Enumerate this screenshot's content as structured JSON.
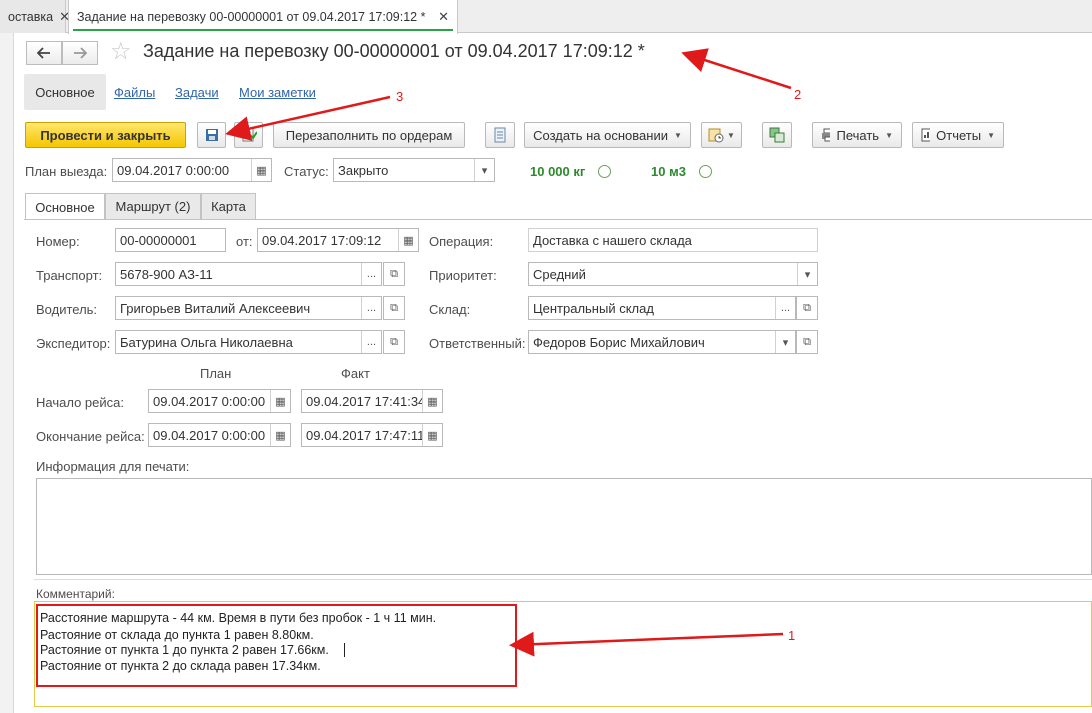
{
  "window_tabs": [
    {
      "label": "оставка",
      "close": "✕"
    },
    {
      "label": "Задание на перевозку 00-00000001 от 09.04.2017 17:09:12 *",
      "close": "✕"
    }
  ],
  "header": {
    "title": "Задание на перевозку 00-00000001 от 09.04.2017 17:09:12 *",
    "back_icon": "arrow-left-icon",
    "forward_icon": "arrow-right-icon",
    "star_icon": "star-icon"
  },
  "sections": {
    "main": "Основное",
    "files": "Файлы",
    "tasks": "Задачи",
    "notes": "Мои заметки"
  },
  "toolbar": {
    "post_close": "Провести и закрыть",
    "refill": "Перезаполнить по ордерам",
    "create_based": "Создать на основании",
    "print": "Печать",
    "reports": "Отчеты"
  },
  "plan_row": {
    "plan_label": "План выезда:",
    "plan_value": "09.04.2017  0:00:00",
    "status_label": "Статус:",
    "status_value": "Закрыто",
    "weight": "10 000 кг",
    "volume": "10 м3"
  },
  "inner_tabs": [
    "Основное",
    "Маршрут (2)",
    "Карта"
  ],
  "form": {
    "number_label": "Номер:",
    "number_value": "00-00000001",
    "from_label": "от:",
    "date_value": "09.04.2017 17:09:12",
    "operation_label": "Операция:",
    "operation_value": "Доставка с нашего склада",
    "transport_label": "Транспорт:",
    "transport_value": "5678-900 АЗ-11",
    "priority_label": "Приоритет:",
    "priority_value": "Средний",
    "driver_label": "Водитель:",
    "driver_value": "Григорьев Виталий Алексеевич",
    "warehouse_label": "Склад:",
    "warehouse_value": "Центральный склад",
    "forwarder_label": "Экспедитор:",
    "forwarder_value": "Батурина Ольга Николаевна",
    "responsible_label": "Ответственный:",
    "responsible_value": "Федоров Борис Михайлович",
    "plan_header": "План",
    "fact_header": "Факт",
    "trip_start_label": "Начало рейса:",
    "trip_start_plan": "09.04.2017  0:00:00",
    "trip_start_fact": "09.04.2017 17:41:34",
    "trip_end_label": "Окончание рейса:",
    "trip_end_plan": "09.04.2017  0:00:00",
    "trip_end_fact": "09.04.2017 17:47:11",
    "print_info_label": "Информация для печати:",
    "comment_label": "Комментарий:",
    "comment_lines": [
      "Расстояние маршрута - 44 км. Время в пути без пробок - 1 ч 11 мин.",
      "Растояние от склада до пункта 1 равен 8.80км.",
      "Растояние от пункта 1 до пункта 2 равен 17.66км.",
      "Растояние от пункта 2 до склада равен 17.34км."
    ]
  },
  "annotations": {
    "n1": "1",
    "n2": "2",
    "n3": "3",
    "color": "#e0191a"
  }
}
